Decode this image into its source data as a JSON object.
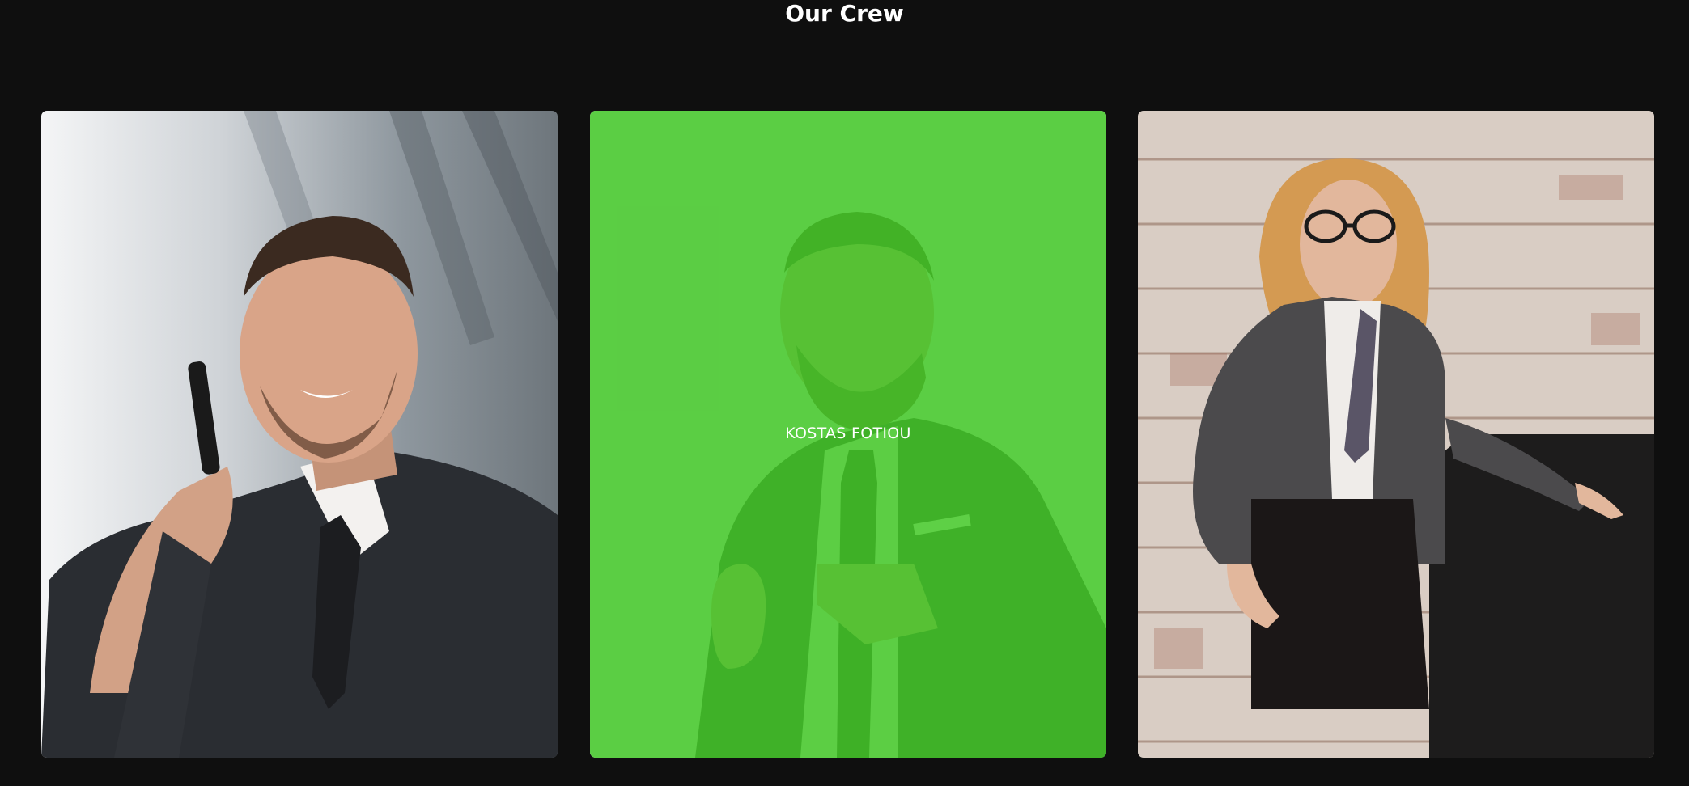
{
  "section": {
    "title": "Our Crew"
  },
  "crew": [
    {
      "name": "",
      "photo": "man-on-phone-photo",
      "hovered": false
    },
    {
      "name": "KOSTAS FOTIOU",
      "photo": "man-thumbs-up-photo",
      "hovered": true
    },
    {
      "name": "",
      "photo": "woman-by-brick-wall-photo",
      "hovered": false
    }
  ],
  "colors": {
    "background": "#0f0f0f",
    "hover_overlay": "#44c828",
    "text": "#ffffff"
  }
}
